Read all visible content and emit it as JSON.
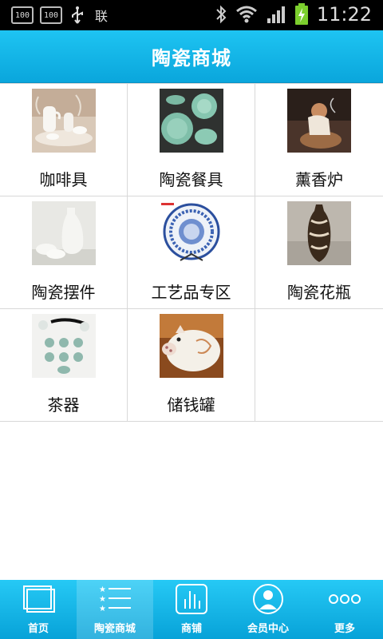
{
  "status_bar": {
    "left_icons": [
      "battery-100-icon",
      "battery-100-icon",
      "usb-icon",
      "sim-icon"
    ],
    "battery_box_text": "100",
    "sim_text": "联",
    "time": "11:22"
  },
  "header": {
    "title": "陶瓷商城"
  },
  "categories": [
    {
      "label": "咖啡具",
      "image": "coffee-set-photo"
    },
    {
      "label": "陶瓷餐具",
      "image": "tableware-photo"
    },
    {
      "label": "薰香炉",
      "image": "incense-burner-photo"
    },
    {
      "label": "陶瓷摆件",
      "image": "ornament-photo"
    },
    {
      "label": "工艺品专区",
      "image": "plate-photo"
    },
    {
      "label": "陶瓷花瓶",
      "image": "vase-photo"
    },
    {
      "label": "茶器",
      "image": "tea-set-photo"
    },
    {
      "label": "储钱罐",
      "image": "piggy-bank-photo"
    }
  ],
  "tabs": [
    {
      "label": "首页",
      "icon": "home-icon",
      "active": false
    },
    {
      "label": "陶瓷商城",
      "icon": "list-icon",
      "active": true
    },
    {
      "label": "商铺",
      "icon": "shop-icon",
      "active": false
    },
    {
      "label": "会员中心",
      "icon": "member-icon",
      "active": false
    },
    {
      "label": "更多",
      "icon": "more-icon",
      "active": false
    }
  ],
  "colors": {
    "accent": "#0aa6dc",
    "header_top": "#1ec4f2"
  }
}
